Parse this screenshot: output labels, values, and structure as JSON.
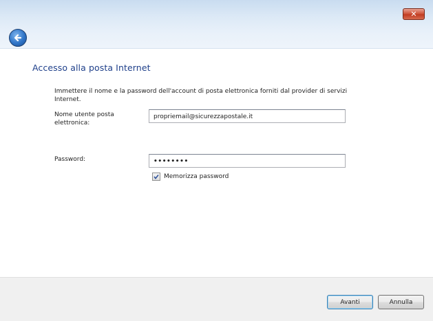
{
  "window": {
    "close_glyph": "✕",
    "back_icon": "back-arrow-icon"
  },
  "main": {
    "heading": "Accesso alla posta Internet",
    "intro": "Immettere il nome e la password dell'account di posta elettronica forniti dal provider di servizi Internet.",
    "username_label": "Nome utente posta elettronica:",
    "username_value": "propriemail@sicurezzapostale.it",
    "password_label": "Password:",
    "password_value": "••••••••",
    "remember_label": "Memorizza password",
    "remember_checked": true
  },
  "footer": {
    "next_label": "Avanti",
    "cancel_label": "Annulla"
  },
  "colors": {
    "heading": "#1e3f8a",
    "close_button": "#c13c22",
    "accent": "#2f74c7"
  }
}
